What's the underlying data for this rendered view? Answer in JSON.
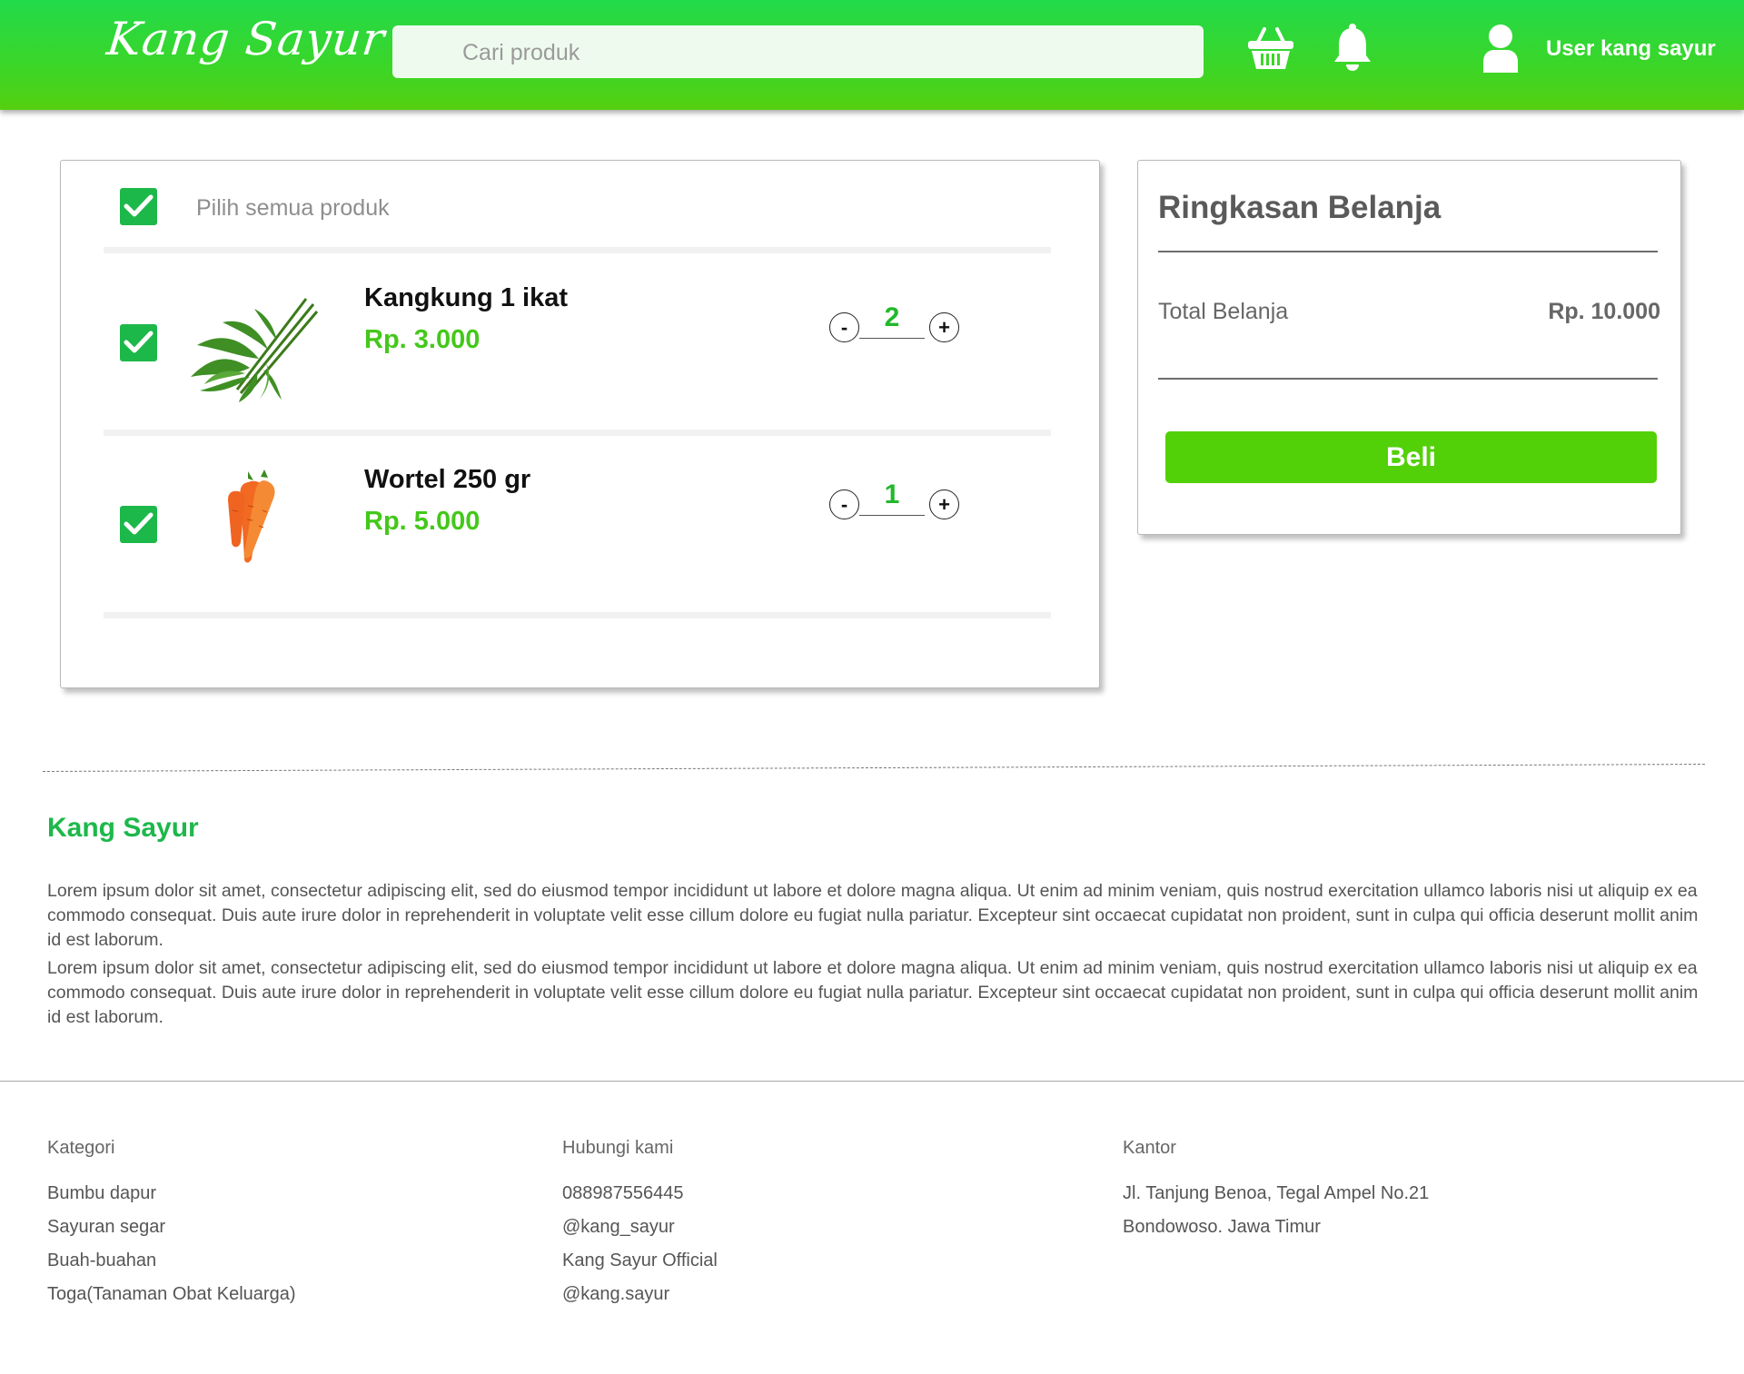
{
  "header": {
    "logo": "Kang Sayur",
    "search_placeholder": "Cari produk",
    "cart_icon": "basket-icon",
    "notification_icon": "bell-icon",
    "user_icon": "user-icon",
    "user_label": "User kang sayur",
    "colors": {
      "gradient_top": "#22da4a",
      "gradient_bottom": "#55d010"
    }
  },
  "cart": {
    "select_all_label": "Pilih semua produk",
    "select_all_checked": true,
    "items": [
      {
        "name": "Kangkung 1 ikat",
        "price": "Rp. 3.000",
        "quantity": "2",
        "checked": true,
        "image": "kangkung-image"
      },
      {
        "name": "Wortel 250 gr",
        "price": "Rp. 5.000",
        "quantity": "1",
        "checked": true,
        "image": "wortel-image"
      }
    ],
    "minus_label": "-",
    "plus_label": "+"
  },
  "summary": {
    "title": "Ringkasan Belanja",
    "total_label": "Total Belanja",
    "total_value": "Rp. 10.000",
    "buy_label": "Beli"
  },
  "about": {
    "title": "Kang Sayur",
    "paragraphs": [
      "Lorem ipsum dolor sit amet, consectetur adipiscing elit, sed do eiusmod tempor incididunt ut labore et dolore magna aliqua. Ut enim ad minim veniam, quis nostrud exercitation ullamco laboris nisi ut aliquip ex ea commodo consequat. Duis aute irure dolor in reprehenderit in voluptate velit esse cillum dolore eu fugiat nulla pariatur. Excepteur sint occaecat cupidatat non proident, sunt in culpa qui officia deserunt mollit anim id est laborum.",
      "Lorem ipsum dolor sit amet, consectetur adipiscing elit, sed do eiusmod tempor incididunt ut labore et dolore magna aliqua. Ut enim ad minim veniam, quis nostrud exercitation ullamco laboris nisi ut aliquip ex ea commodo consequat. Duis aute irure dolor in reprehenderit in voluptate velit esse cillum dolore eu fugiat nulla pariatur. Excepteur sint occaecat cupidatat non proident, sunt in culpa qui officia deserunt mollit anim id est laborum."
    ]
  },
  "footer": {
    "kategori": {
      "heading": "Kategori",
      "items": [
        "Bumbu dapur",
        "Sayuran segar",
        "Buah-buahan",
        "Toga(Tanaman Obat Keluarga)"
      ]
    },
    "hubungi": {
      "heading": "Hubungi kami",
      "items": [
        "088987556445",
        "@kang_sayur",
        "Kang Sayur Official",
        "@kang.sayur"
      ]
    },
    "kantor": {
      "heading": "Kantor",
      "items": [
        "Jl. Tanjung Benoa, Tegal Ampel No.21",
        "Bondowoso. Jawa Timur"
      ]
    }
  }
}
